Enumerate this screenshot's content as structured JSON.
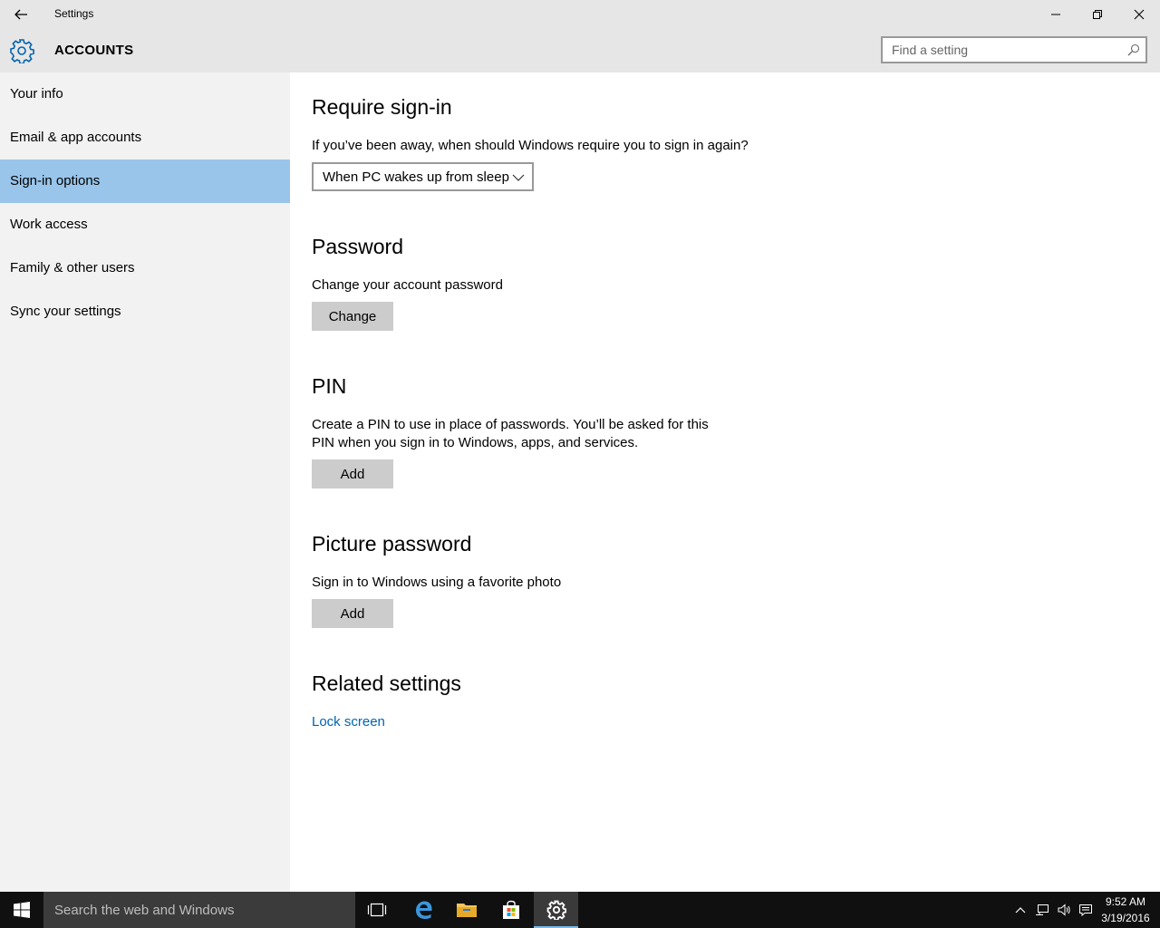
{
  "window": {
    "title": "Settings"
  },
  "header": {
    "page_title": "ACCOUNTS",
    "search_placeholder": "Find a setting"
  },
  "sidebar": {
    "items": [
      {
        "label": "Your info"
      },
      {
        "label": "Email & app accounts"
      },
      {
        "label": "Sign-in options",
        "selected": true
      },
      {
        "label": "Work access"
      },
      {
        "label": "Family & other users"
      },
      {
        "label": "Sync your settings"
      }
    ]
  },
  "main": {
    "require_signin": {
      "heading": "Require sign-in",
      "description": "If you’ve been away, when should Windows require you to sign in again?",
      "dropdown_value": "When PC wakes up from sleep"
    },
    "password": {
      "heading": "Password",
      "description": "Change your account password",
      "button_label": "Change"
    },
    "pin": {
      "heading": "PIN",
      "description_line1": "Create a PIN to use in place of passwords. You’ll be asked for this",
      "description_line2": "PIN when you sign in to Windows, apps, and services.",
      "button_label": "Add"
    },
    "picture_password": {
      "heading": "Picture password",
      "description": "Sign in to Windows using a favorite photo",
      "button_label": "Add"
    },
    "related": {
      "heading": "Related settings",
      "link_label": "Lock screen"
    }
  },
  "taskbar": {
    "search_text": "Search the web and Windows",
    "clock_time": "9:52 AM",
    "clock_date": "3/19/2016"
  },
  "colors": {
    "accent": "#0063b1",
    "selected_nav": "#99c5ea",
    "sidebar_bg": "#f2f2f2",
    "titlebar_bg": "#e6e6e6",
    "taskbar_bg": "#101010"
  }
}
